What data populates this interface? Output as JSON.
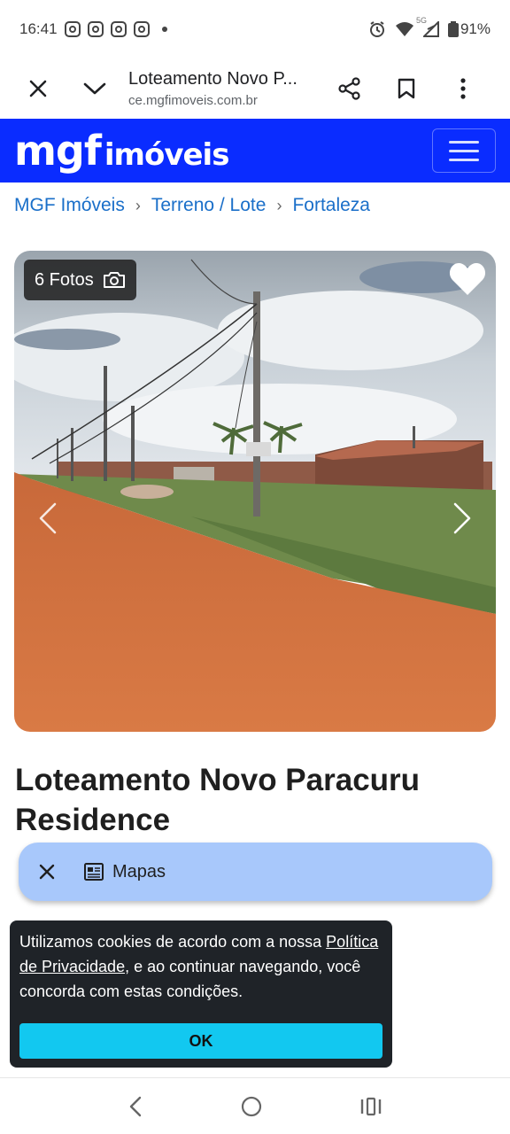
{
  "status_bar": {
    "time": "16:41",
    "battery": "91%",
    "signal_label": "5G"
  },
  "browser": {
    "page_title": "Loteamento Novo P...",
    "host": "ce.mgfimoveis.com.br"
  },
  "site": {
    "logo_main": "mgf",
    "logo_sub": "imóveis",
    "brand_color": "#0a2cff"
  },
  "breadcrumb": {
    "items": [
      "MGF Imóveis",
      "Terreno / Lote",
      "Fortaleza"
    ],
    "separator": "›"
  },
  "gallery": {
    "photo_count_label": "6 Fotos"
  },
  "listing": {
    "title": "Loteamento Novo Paracuru Residence"
  },
  "map_chip": {
    "label": "Mapas"
  },
  "cookie": {
    "text_before": "Utilizamos cookies de acordo com a nossa ",
    "link": "Política de Privacidade",
    "text_after": ", e ao continuar navegando, você concorda com estas condições.",
    "button": "OK",
    "button_color": "#12c8f0"
  }
}
